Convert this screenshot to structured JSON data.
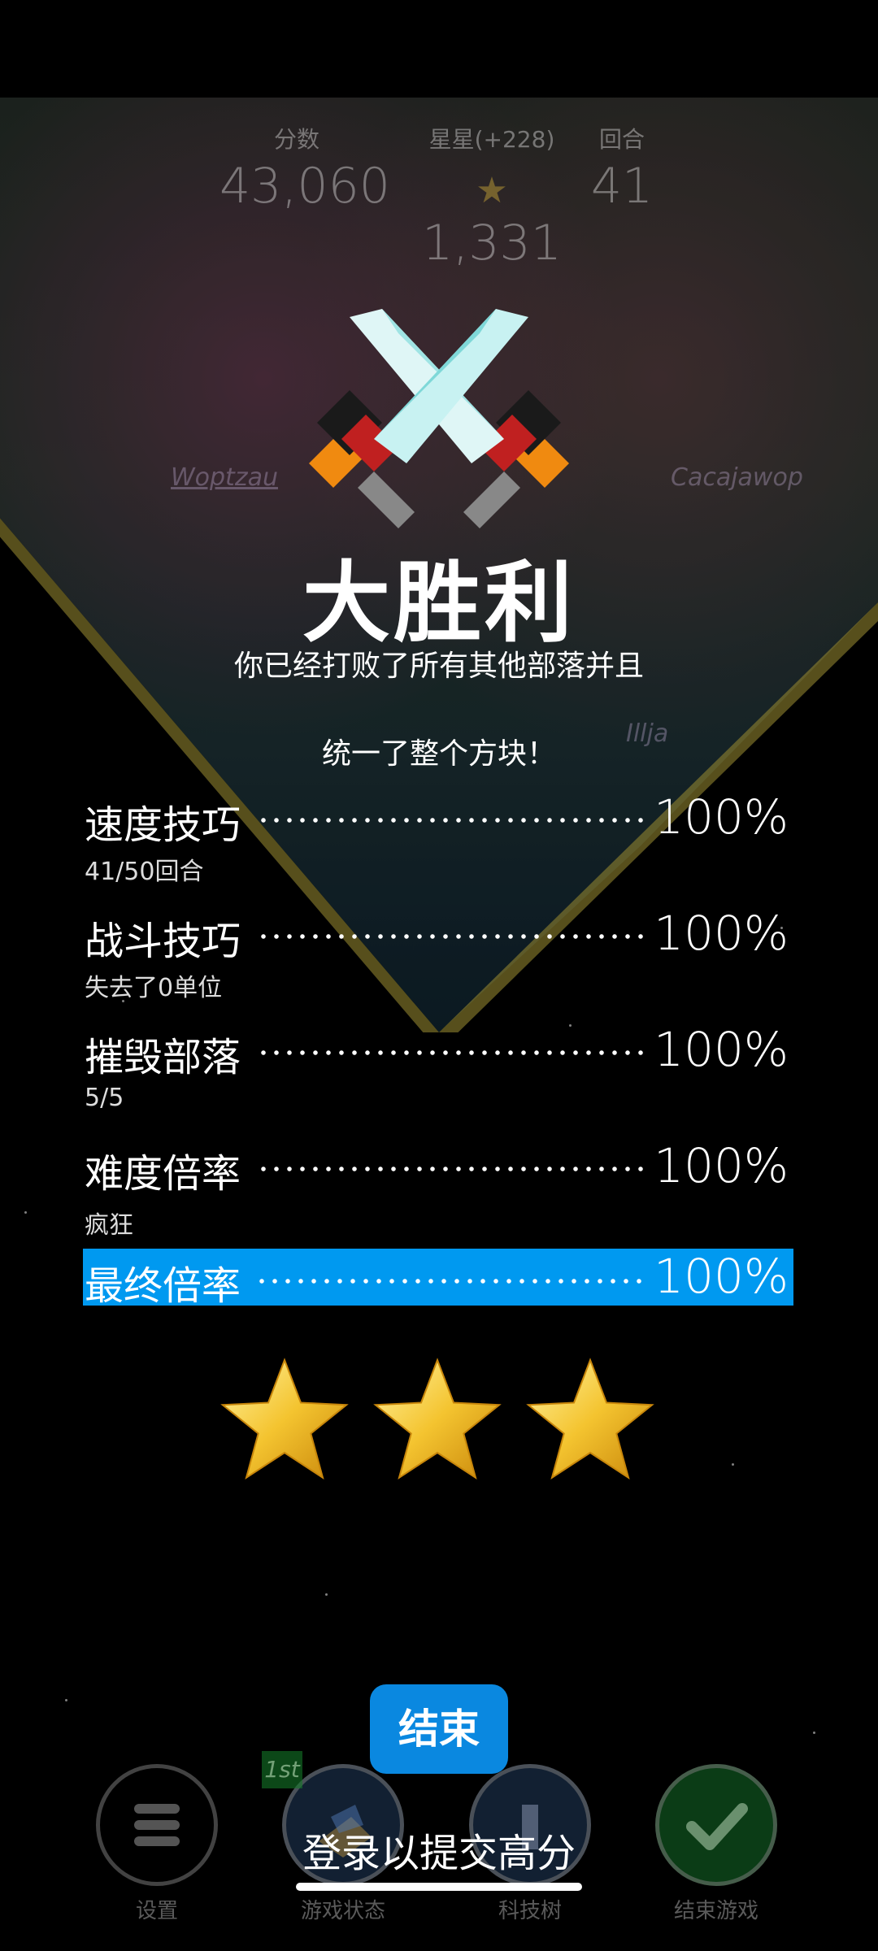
{
  "header": {
    "score_label": "分数",
    "score_value": "43,060",
    "stars_label": "星星(+228)",
    "stars_value": "1,331",
    "turn_label": "回合",
    "turn_value": "41"
  },
  "map_labels": {
    "tribe_1": "Woptzau",
    "tribe_2": "Cacajawop",
    "tribe_3": "Illja"
  },
  "result": {
    "title": "大胜利",
    "subtitle_line1": "你已经打败了所有其他部落并且",
    "subtitle_line2": "统一了整个方块！"
  },
  "scores": [
    {
      "name": "速度技巧",
      "percent": "100%",
      "detail": "41/50回合"
    },
    {
      "name": "战斗技巧",
      "percent": "100%",
      "detail": "失去了0单位"
    },
    {
      "name": "摧毁部落",
      "percent": "100%",
      "detail": "5/5"
    },
    {
      "name": "难度倍率",
      "percent": "100%",
      "detail": "疯狂"
    },
    {
      "name": "最终倍率",
      "percent": "100%"
    }
  ],
  "rating": {
    "stars": 3,
    "max": 3
  },
  "colors": {
    "accent": "#0099f0",
    "star_gold": "#f4c430",
    "button_blue": "#0a88e0"
  },
  "buttons": {
    "end_label": "结束",
    "login_label": "登录以提交高分"
  },
  "nav": [
    {
      "label": "设置",
      "icon": "menu-icon"
    },
    {
      "label": "游戏状态",
      "icon": "game-status-icon",
      "badge": "1st"
    },
    {
      "label": "科技树",
      "icon": "tech-tree-icon"
    },
    {
      "label": "结束游戏",
      "icon": "checkmark-icon"
    }
  ]
}
